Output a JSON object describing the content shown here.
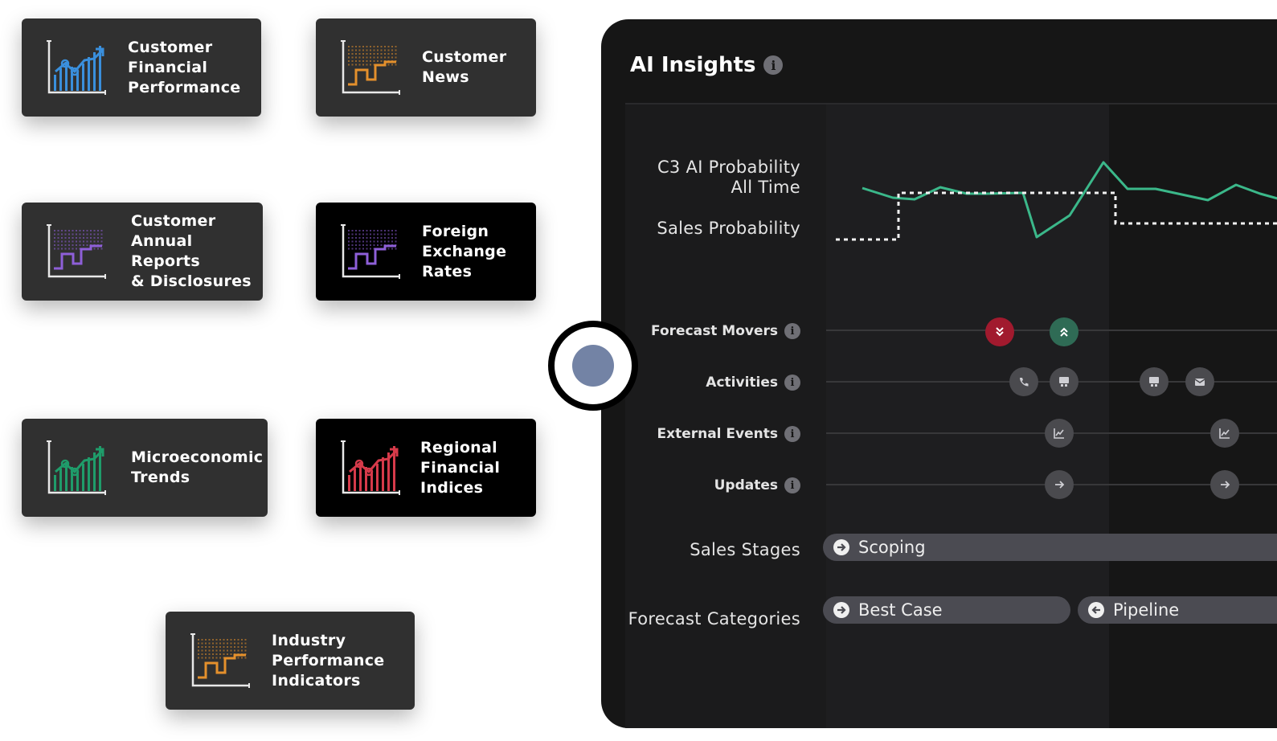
{
  "tiles": [
    {
      "label": "Customer\nFinancial\nPerformance",
      "icon": "line-bar-chart-icon",
      "color": "#3a8fdc",
      "bg": "gray"
    },
    {
      "label": "Customer\nNews",
      "icon": "step-chart-icon",
      "color": "#e4902c",
      "bg": "gray"
    },
    {
      "label": "Customer\nAnnual Reports\n& Disclosures",
      "icon": "step-chart-icon",
      "color": "#8e5fd8",
      "bg": "gray"
    },
    {
      "label": "Foreign\nExchange\nRates",
      "icon": "step-chart-icon",
      "color": "#8e5fd8",
      "bg": "black"
    },
    {
      "label": "Microeconomic\nTrends",
      "icon": "line-bar-chart-icon",
      "color": "#1f9c6a",
      "bg": "gray"
    },
    {
      "label": "Regional\nFinancial\nIndices",
      "icon": "line-bar-chart-icon",
      "color": "#d63a4a",
      "bg": "black"
    },
    {
      "label": "Industry\nPerformance\nIndicators",
      "icon": "step-chart-icon",
      "color": "#e4902c",
      "bg": "gray"
    }
  ],
  "panel": {
    "title": "AI Insights",
    "info_glyph": "i",
    "rows": {
      "probability": "C3 AI Probability\nAll Time",
      "sales_probability": "Sales Probability",
      "forecast_movers": "Forecast Movers",
      "activities": "Activities",
      "external_events": "External Events",
      "updates": "Updates",
      "sales_stages": "Sales Stages",
      "forecast_categories": "Forecast Categories"
    },
    "forecast_movers": [
      {
        "icon": "double-chevron-down-icon",
        "status": "red"
      },
      {
        "icon": "double-chevron-up-icon",
        "status": "green"
      }
    ],
    "activities": [
      "phone-icon",
      "meeting-icon",
      "meeting-icon",
      "email-icon"
    ],
    "external_events": [
      "chart-icon",
      "chart-icon"
    ],
    "updates": [
      "arrow-right-icon",
      "arrow-right-icon"
    ],
    "sales_stage": "Scoping",
    "forecast_categories": [
      "Best Case",
      "Pipeline"
    ]
  },
  "colors": {
    "probability_line": "#3bb88a",
    "mover_down": "#a11a2e",
    "mover_up": "#2f6b55",
    "knob": "#7383a5"
  }
}
